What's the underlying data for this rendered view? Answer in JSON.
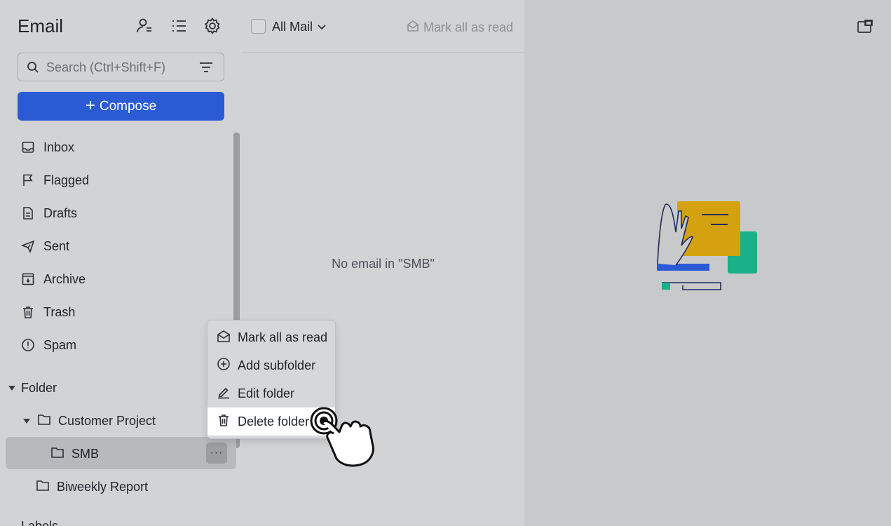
{
  "sidebar": {
    "app_title": "Email",
    "header_icons": [
      "contacts-icon",
      "list-view-icon",
      "settings-icon"
    ],
    "search": {
      "placeholder": "Search (Ctrl+Shift+F)"
    },
    "compose_label": "Compose",
    "nav": [
      {
        "label": "Inbox",
        "icon": "inbox-icon"
      },
      {
        "label": "Flagged",
        "icon": "flag-icon"
      },
      {
        "label": "Drafts",
        "icon": "draft-icon"
      },
      {
        "label": "Sent",
        "icon": "send-icon"
      },
      {
        "label": "Archive",
        "icon": "archive-icon"
      },
      {
        "label": "Trash",
        "icon": "trash-icon"
      },
      {
        "label": "Spam",
        "icon": "spam-icon"
      }
    ],
    "folder_header": "Folder",
    "folders": {
      "customer_project": "Customer Project",
      "smb": "SMB",
      "biweekly": "Biweekly Report"
    },
    "more_label": "···",
    "labels_header": "Labels"
  },
  "list": {
    "filter_label": "All Mail",
    "mark_all_read": "Mark all as read",
    "empty_message": "No email in \"SMB\""
  },
  "context_menu": {
    "items": [
      {
        "label": "Mark all as read",
        "icon": "envelope-open-icon"
      },
      {
        "label": "Add subfolder",
        "icon": "plus-circle-icon"
      },
      {
        "label": "Edit folder",
        "icon": "pencil-icon"
      },
      {
        "label": "Delete folder",
        "icon": "trash-icon"
      }
    ]
  },
  "colors": {
    "accent": "#2a5bd4",
    "sidebar_bg": "#d2d3d5",
    "selected_row": "#b8b9bc",
    "illustration_yellow": "#d4a20f",
    "illustration_green": "#19b08a"
  }
}
